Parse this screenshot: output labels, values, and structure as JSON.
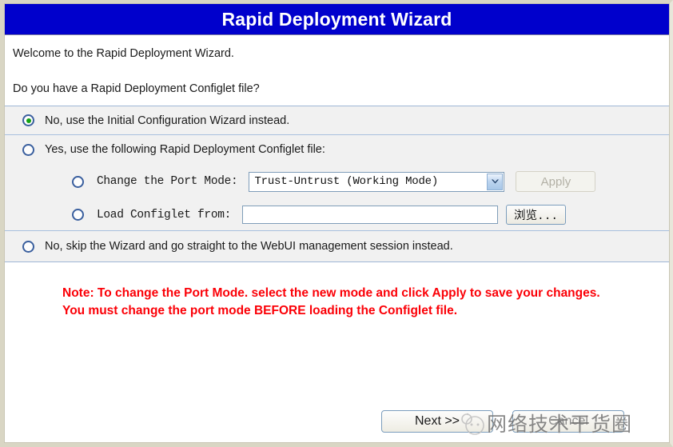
{
  "window": {
    "title": "Rapid Deployment Wizard",
    "title_bar_color": "#0000CC",
    "title_text_color": "#FFFFFF"
  },
  "intro": {
    "line1": "Welcome to the Rapid Deployment Wizard.",
    "line2": "Do you have a Rapid Deployment Configlet file?"
  },
  "options": {
    "no_initial_config": {
      "label": "No, use the Initial Configuration Wizard instead.",
      "selected": true,
      "indicator_color": "#13A313"
    },
    "yes_configlet": {
      "label": "Yes, use the following Rapid Deployment Configlet file:",
      "selected": false
    },
    "port_mode": {
      "label": "Change the Port Mode:",
      "selected": false,
      "select_value": "Trust-Untrust  (Working Mode)",
      "select_options": [
        "Trust-Untrust  (Working Mode)"
      ],
      "apply_label": "Apply",
      "apply_enabled": false
    },
    "load_configlet": {
      "label": "Load Configlet from:",
      "selected": false,
      "path_value": "",
      "path_placeholder": "",
      "browse_label": "浏览..."
    },
    "skip_wizard": {
      "label": "No, skip the Wizard and go straight to the WebUI management session instead.",
      "selected": false
    }
  },
  "note": {
    "text": "Note: To change the Port Mode. select the new mode and click Apply to save your changes. You must change the port mode BEFORE loading the Configlet file.",
    "color": "#FB0007"
  },
  "footer": {
    "next_label": "Next >>",
    "cancel_label": "Cancel"
  },
  "watermark": {
    "text": "网络技术干货圈"
  }
}
